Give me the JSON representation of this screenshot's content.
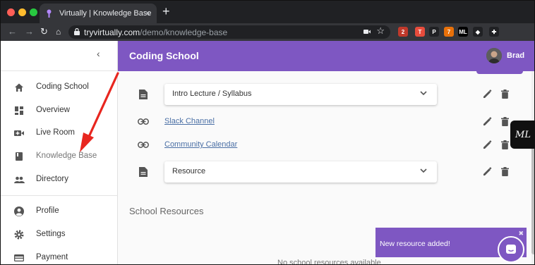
{
  "browser": {
    "tab_title": "Virtually | Knowledge Base",
    "tab_close": "×",
    "new_tab": "+",
    "url_host": "tryvirtually.com",
    "url_path": "/demo/knowledge-base",
    "nav_back": "←",
    "nav_forward": "→",
    "nav_reload": "↻",
    "star": "☆",
    "menu": "⋮",
    "extensions": [
      {
        "name": "ext-badge-2",
        "color": "#c0392b",
        "text": "2"
      },
      {
        "name": "ext-red-t",
        "color": "#e74c3c",
        "text": "T"
      },
      {
        "name": "ext-p",
        "color": "#202124",
        "text": "P"
      },
      {
        "name": "ext-badge-7",
        "color": "#e8710a",
        "text": "7"
      },
      {
        "name": "ext-ml",
        "color": "#000000",
        "text": "ML"
      },
      {
        "name": "ext-layers",
        "color": "#202124",
        "text": "◆"
      },
      {
        "name": "ext-puzzle",
        "color": "#202124",
        "text": "✚"
      }
    ]
  },
  "sidebar": {
    "collapse_icon": "‹",
    "items": [
      {
        "label": "Coding School",
        "icon": "home-icon"
      },
      {
        "label": "Overview",
        "icon": "dashboard-icon"
      },
      {
        "label": "Live Room",
        "icon": "video-add-icon"
      },
      {
        "label": "Knowledge Base",
        "icon": "book-icon",
        "active": true
      },
      {
        "label": "Directory",
        "icon": "people-icon"
      },
      {
        "label": "Profile",
        "icon": "account-circle-icon"
      },
      {
        "label": "Settings",
        "icon": "gear-icon"
      },
      {
        "label": "Payment",
        "icon": "credit-card-icon"
      }
    ]
  },
  "header": {
    "title": "Coding School",
    "user_name": "Brad"
  },
  "resources": {
    "items": [
      {
        "type": "doc",
        "label": "Intro Lecture / Syllabus"
      },
      {
        "type": "link",
        "label": "Slack Channel"
      },
      {
        "type": "link",
        "label": "Community Calendar"
      },
      {
        "type": "doc",
        "label": "Resource"
      }
    ]
  },
  "school_resources": {
    "title": "School Resources",
    "empty_text": "No school resources available"
  },
  "floating_badge": "ML",
  "toast": {
    "message": "New resource added!",
    "close": "✖"
  },
  "colors": {
    "brand": "#7e57c2",
    "link": "#4a6fa5",
    "arrow": "#e8261f"
  }
}
